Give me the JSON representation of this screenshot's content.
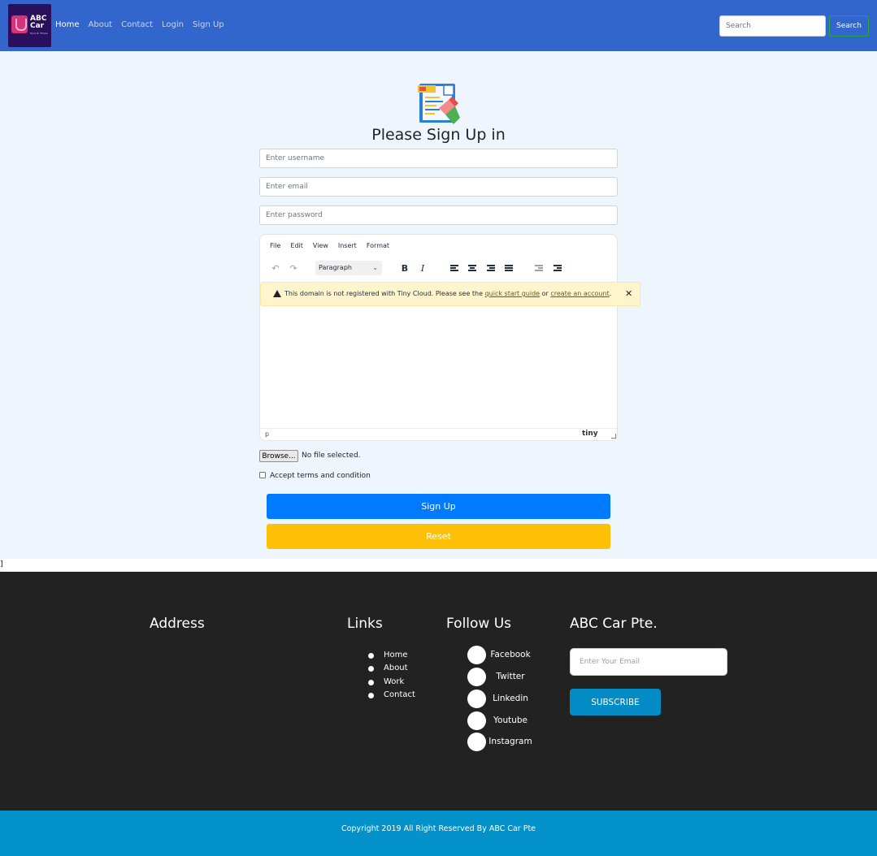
{
  "navbar": {
    "logo_line1": "ABC",
    "logo_line2": "Car",
    "logo_tagline": "Tune To Thrive",
    "links": [
      "Home",
      "About",
      "Contact",
      "Login",
      "Sign Up"
    ],
    "active_link": "Home",
    "search_placeholder": "Search",
    "search_button": "Search"
  },
  "form": {
    "icon": "form-edit-icon",
    "title": "Please Sign Up in",
    "username_placeholder": "Enter username",
    "email_placeholder": "Enter email",
    "password_placeholder": "Enter password"
  },
  "editor": {
    "menu": [
      "File",
      "Edit",
      "View",
      "Insert",
      "Format"
    ],
    "block_format": "Paragraph",
    "toolbar_icons": [
      "undo-icon",
      "redo-icon",
      "bold-icon",
      "italic-icon",
      "align-left-icon",
      "align-center-icon",
      "align-right-icon",
      "align-justify-icon",
      "outdent-icon",
      "indent-icon"
    ],
    "bold_label": "B",
    "italic_label": "I",
    "warning_text": "This domain is not registered with Tiny Cloud. Please see the",
    "warning_link1": "quick start guide",
    "warning_or": "or",
    "warning_link2": "create an account",
    "warning_end": ".",
    "status_path": "p",
    "brand": "tiny"
  },
  "file": {
    "button": "Browse...",
    "label": "No file selected."
  },
  "terms_label": "Accept terms and condition",
  "buttons": {
    "signup": "Sign Up",
    "reset": "Reset"
  },
  "stray_text": "]",
  "footer": {
    "address_heading": "Address",
    "links_heading": "Links",
    "links": [
      "Home",
      "About",
      "Work",
      "Contact"
    ],
    "follow_heading": "Follow Us",
    "social": [
      "Facebook",
      "Twitter",
      "Linkedin",
      "Youtube",
      "Instagram"
    ],
    "company_heading": "ABC Car Pte.",
    "email_placeholder": "Enter Your Email",
    "subscribe": "SUBSCRIBE",
    "copyright": "Copyright 2019 All Right Reserved By ABC Car Pte"
  },
  "colors": {
    "navbar": "#3366cc",
    "main_bg": "#eef5fd",
    "primary": "#007bff",
    "warning": "#ffc107",
    "footer": "#222222",
    "footer_bar": "#0291c9"
  }
}
